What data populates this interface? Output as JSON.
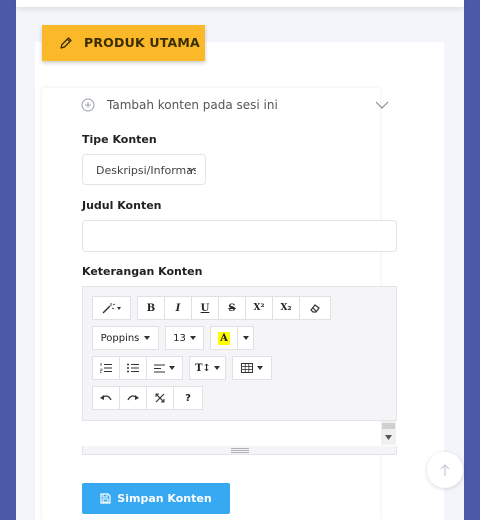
{
  "section_badge": {
    "label": "PRODUK UTAMA",
    "icon": "pencil-icon",
    "color": "#fbb829"
  },
  "accordion": {
    "label": "Tambah konten pada sesi ini",
    "icon": "plus-circle-icon",
    "toggle_icon": "chevron-down-icon"
  },
  "form": {
    "type_label": "Tipe Konten",
    "type_value": "Deskripsi/Informasi",
    "title_label": "Judul Konten",
    "title_value": "",
    "desc_label": "Keterangan Konten"
  },
  "toolbar": {
    "font_family": "Poppins",
    "font_size": "13",
    "bold": "B",
    "italic": "I",
    "underline": "U",
    "strike": "S",
    "superscript": "X²",
    "subscript": "X₂",
    "highlight": "A",
    "text_size": "T↕",
    "help": "?"
  },
  "save_button": {
    "label": "Simpan Konten",
    "color": "#36a9f2"
  }
}
